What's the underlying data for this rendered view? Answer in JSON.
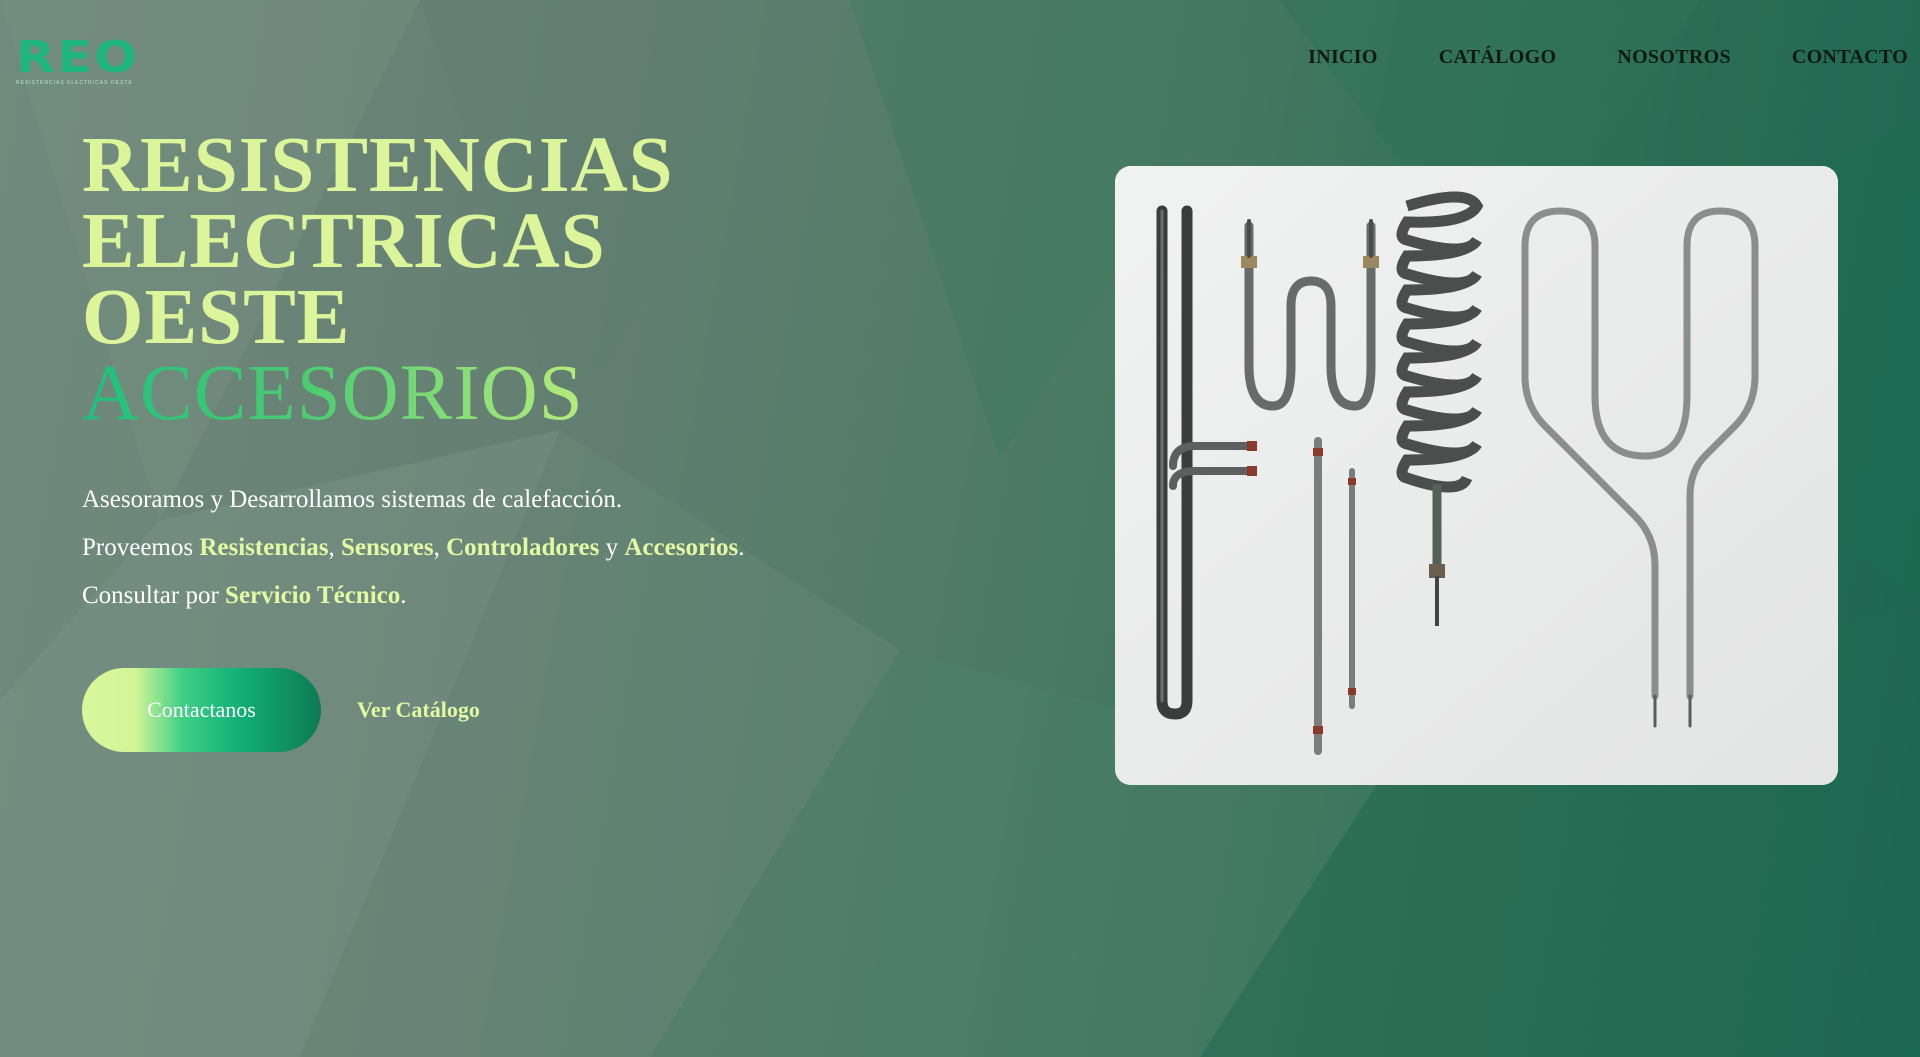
{
  "brand": {
    "logo_text": "REO",
    "logo_subtitle": "RESISTENCIAS ELECTRICAS OESTE"
  },
  "nav": {
    "items": [
      {
        "label": "INICIO"
      },
      {
        "label": "CATÁLOGO"
      },
      {
        "label": "NOSOTROS"
      },
      {
        "label": "CONTACTO"
      }
    ]
  },
  "hero": {
    "title_lines": [
      "RESISTENCIAS",
      "ELECTRICAS",
      "OESTE"
    ],
    "title_accent": "ACCESORIOS",
    "line1": "Asesoramos y Desarrollamos sistemas de calefacción.",
    "line2": {
      "prefix": "Proveemos ",
      "h1": "Resistencias",
      "sep1": ", ",
      "h2": "Sensores",
      "sep2": ", ",
      "h3": "Controladores",
      "sep3": " y ",
      "h4": "Accesorios",
      "end": "."
    },
    "line3": {
      "prefix": "Consultar por ",
      "h1": "Servicio Técnico",
      "end": "."
    },
    "primary_button": "Contactanos",
    "secondary_link": "Ver Catálogo"
  },
  "colors": {
    "title": "#dcf59a",
    "accent_green": "#1fb57e",
    "highlight": "#e3f9a4",
    "nav_text": "#0f1a14"
  }
}
